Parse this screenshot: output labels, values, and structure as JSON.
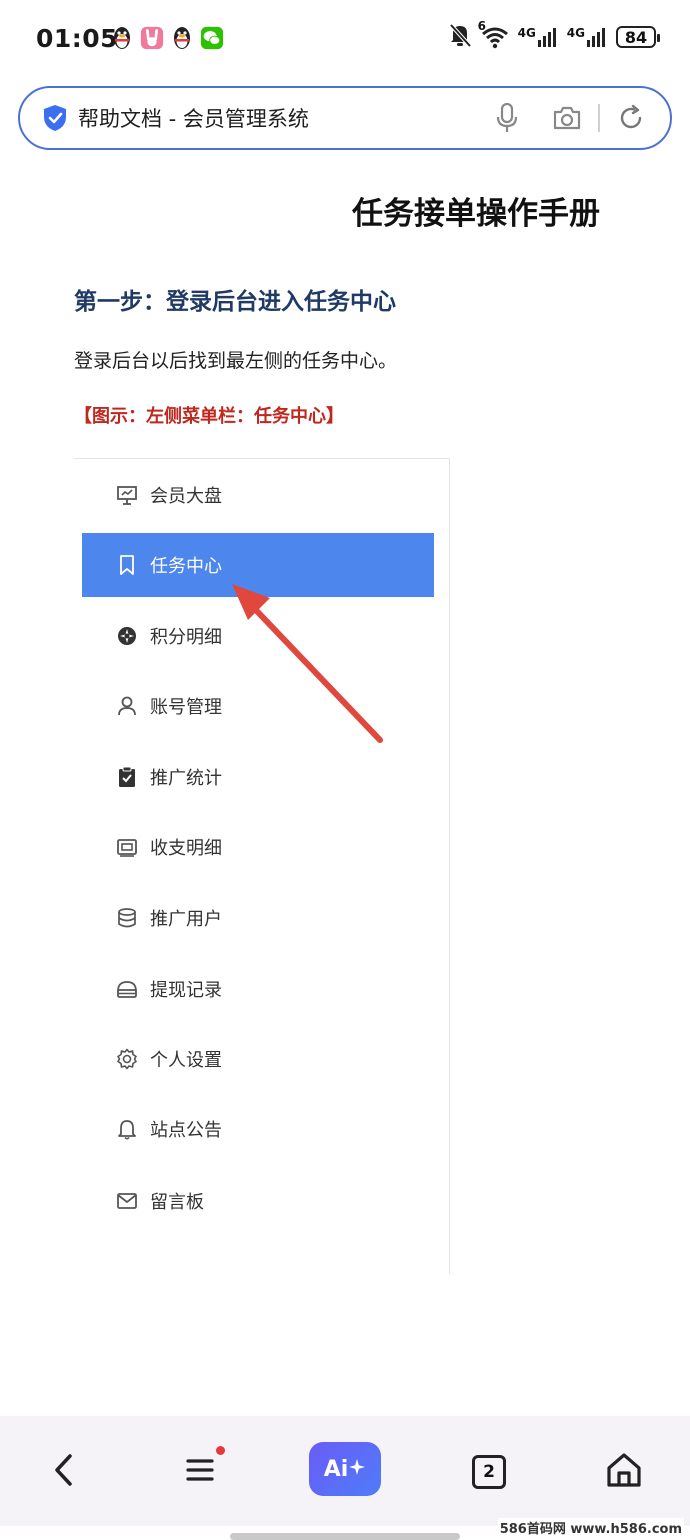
{
  "status_bar": {
    "time": "01:05",
    "network_labels": [
      "4G",
      "4G"
    ],
    "wifi_label": "6",
    "battery": "84"
  },
  "address_bar": {
    "page_title": "帮助文档 - 会员管理系统"
  },
  "document": {
    "title": "任务接单操作手册",
    "step_heading": "第一步：登录后台进入任务中心",
    "step_desc": "登录后台以后找到最左侧的任务中心。",
    "figure_caption": "【图示：左侧菜单栏：任务中心】"
  },
  "sidebar_menu": {
    "items": [
      {
        "label": "会员大盘",
        "icon": "presentation-chart-icon",
        "active": false
      },
      {
        "label": "任务中心",
        "icon": "bookmark-icon",
        "active": true
      },
      {
        "label": "积分明细",
        "icon": "compass-icon",
        "active": false
      },
      {
        "label": "账号管理",
        "icon": "user-icon",
        "active": false
      },
      {
        "label": "推广统计",
        "icon": "clipboard-check-icon",
        "active": false
      },
      {
        "label": "收支明细",
        "icon": "money-icon",
        "active": false
      },
      {
        "label": "推广用户",
        "icon": "database-icon",
        "active": false
      },
      {
        "label": "提现记录",
        "icon": "wallet-icon",
        "active": false
      },
      {
        "label": "个人设置",
        "icon": "gear-icon",
        "active": false
      },
      {
        "label": "站点公告",
        "icon": "bell-icon",
        "active": false
      },
      {
        "label": "留言板",
        "icon": "mail-icon",
        "active": false
      }
    ],
    "active_color": "#4d86ec"
  },
  "bottom_nav": {
    "ai_label": "Ai",
    "tabs_count": "2"
  },
  "watermark": "586首码网 www.h586.com",
  "colors": {
    "heading_blue": "#1f3a64",
    "caption_red": "#c0271f",
    "arrow_red": "#e0483e",
    "address_border": "#4a6fd6"
  }
}
